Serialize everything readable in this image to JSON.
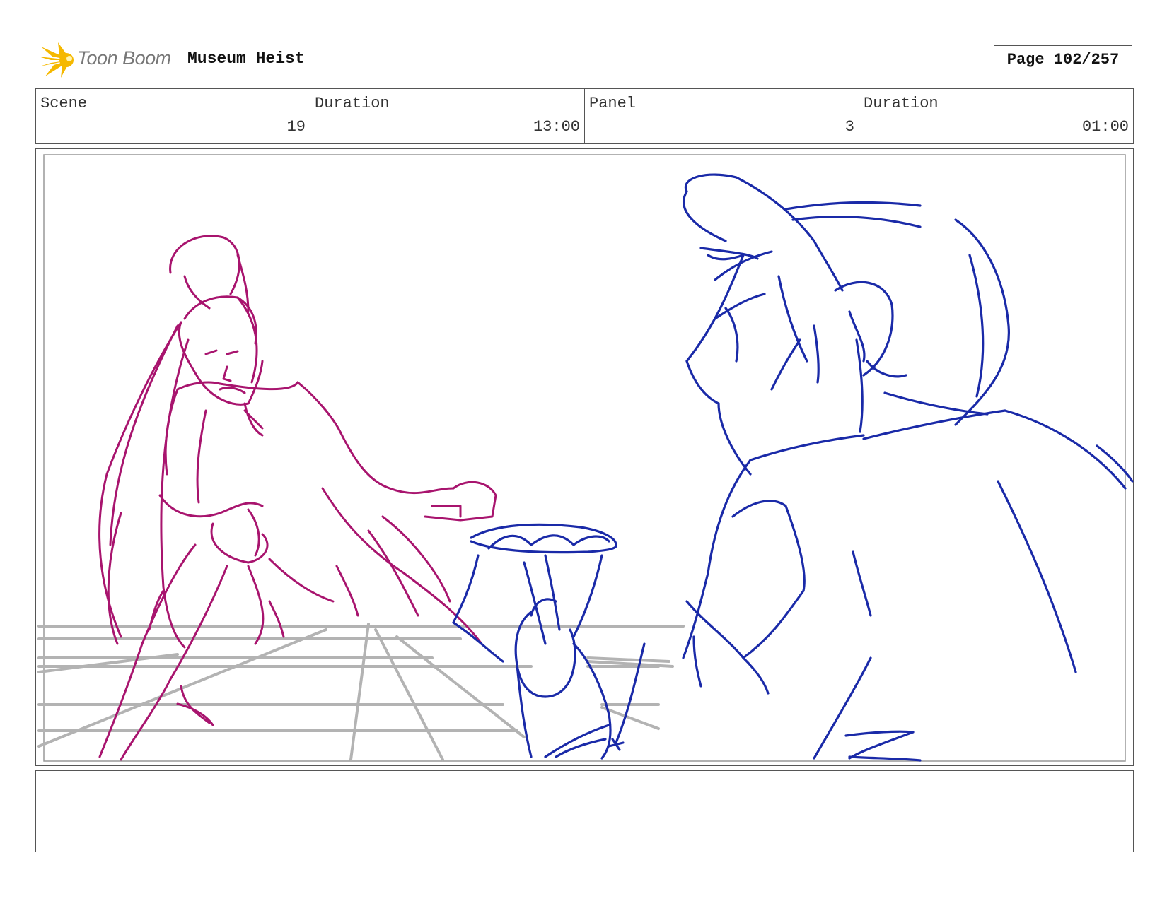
{
  "header": {
    "logo_text": "Toon Boom",
    "project_title": "Museum Heist",
    "page_indicator": "Page 102/257"
  },
  "info": {
    "scene_label": "Scene",
    "scene_value": "19",
    "scene_duration_label": "Duration",
    "scene_duration_value": "13:00",
    "panel_label": "Panel",
    "panel_value": "3",
    "panel_duration_label": "Duration",
    "panel_duration_value": "01:00"
  },
  "notes": {
    "text": ""
  },
  "colors": {
    "heroine_sketch": "#a8146e",
    "hero_sketch": "#1a2aa8",
    "perspective_grid": "#b3b3b3",
    "logo_yellow": "#f5b800"
  }
}
